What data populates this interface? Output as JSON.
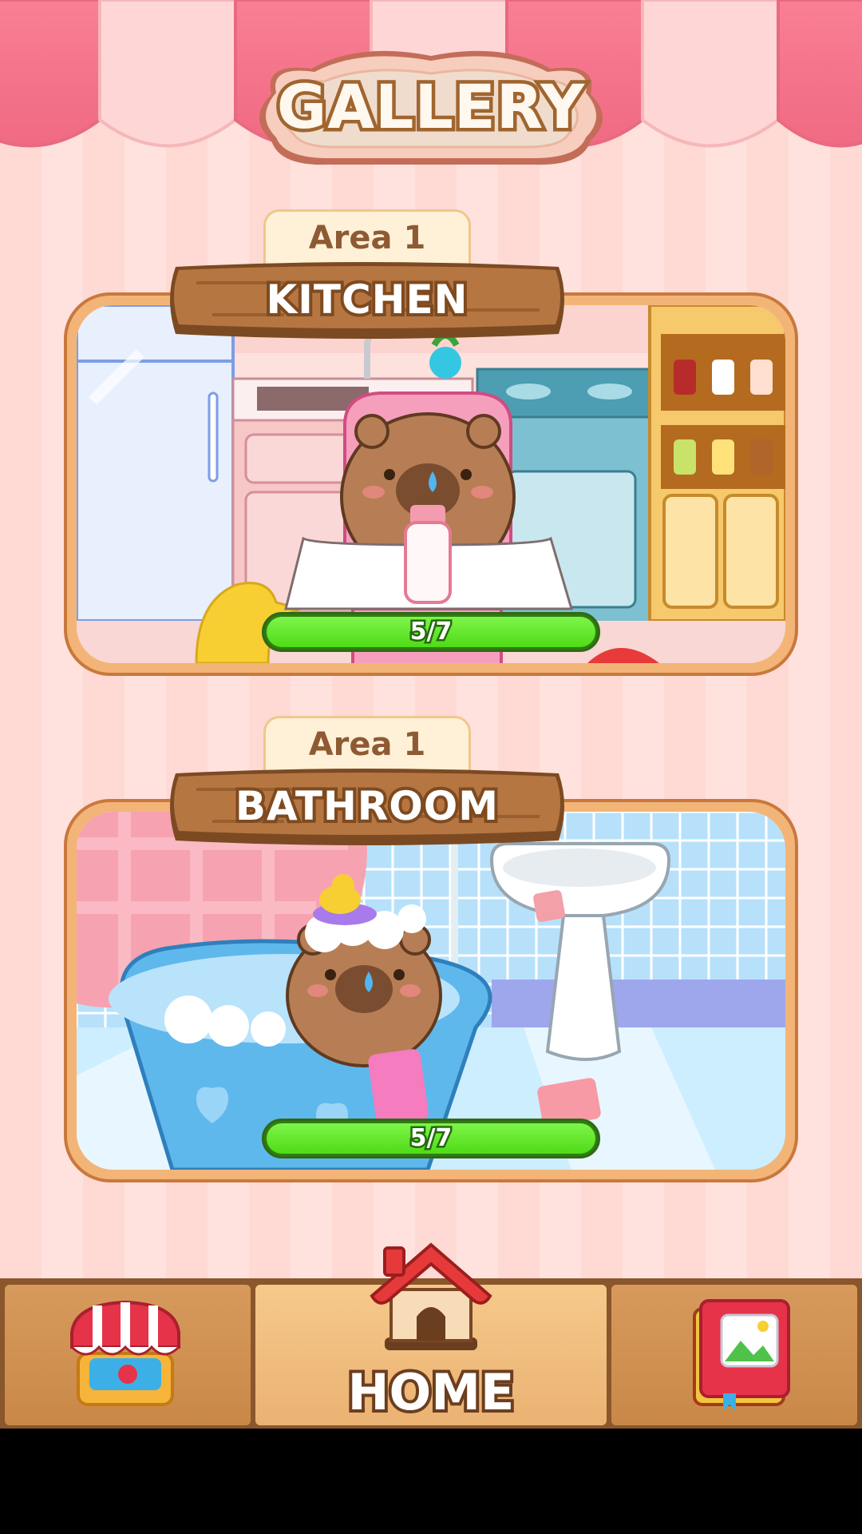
{
  "header": {
    "title": "GALLERY"
  },
  "colors": {
    "awning_pink": "#f57e92",
    "awning_light": "#ffd9da",
    "progress_green": "#4fdb16",
    "wood": "#b67642"
  },
  "areas": [
    {
      "area_label": "Area 1",
      "room_name": "KITCHEN",
      "progress_text": "5/7",
      "progress_fraction": 0.714
    },
    {
      "area_label": "Area 1",
      "room_name": "BATHROOM",
      "progress_text": "5/7",
      "progress_fraction": 0.714
    }
  ],
  "nav": {
    "items": [
      {
        "id": "shop",
        "icon": "shop-stall-icon",
        "active": false
      },
      {
        "id": "home",
        "icon": "house-icon",
        "label": "HOME",
        "active": true
      },
      {
        "id": "gallery",
        "icon": "photo-book-icon",
        "active": false
      }
    ]
  }
}
